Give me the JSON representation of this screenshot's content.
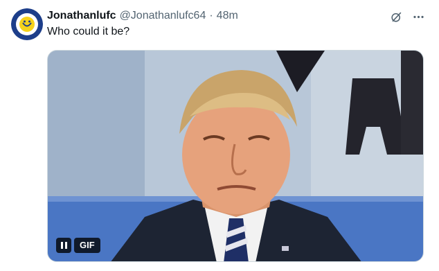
{
  "tweet": {
    "author_name": "Jonathanlufc",
    "author_handle": "@Jonathanlufc64",
    "separator": "·",
    "time_ago": "48m",
    "text": "Who could it be?",
    "avatar": {
      "icon": "leeds-united-crest",
      "colors": [
        "#1d3e8a",
        "#f6d21b",
        "#ffffff"
      ]
    },
    "actions": {
      "grok_icon": "grok-icon",
      "more_icon": "more-icon"
    },
    "media": {
      "type": "gif",
      "badge_label": "GIF",
      "pause_icon": "pause-icon"
    }
  },
  "colors": {
    "text_primary": "#0f1419",
    "text_secondary": "#536471",
    "border": "#cfd9de"
  }
}
